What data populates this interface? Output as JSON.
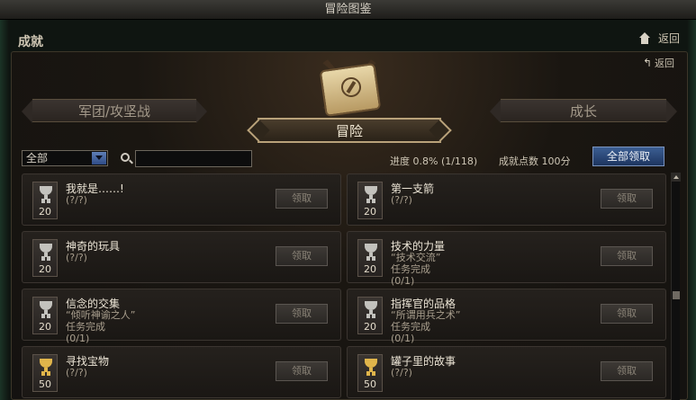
{
  "window": {
    "title": "冒险图鉴"
  },
  "header": {
    "section_title": "成就",
    "back_label": "返回",
    "secondary_back_label": "返回"
  },
  "tabs": {
    "left": "军团/攻坚战",
    "center": "冒险",
    "right": "成长"
  },
  "filter": {
    "selected": "全部"
  },
  "search": {
    "value": "",
    "placeholder": ""
  },
  "stats": {
    "progress_text": "进度  0.8% (1/118)",
    "points_text": "成就点数 100分",
    "claim_all_label": "全部领取"
  },
  "claim_label": "领取",
  "achievements": [
    {
      "title": "我就是……!",
      "points": "20",
      "trophy": "silver",
      "lines": [
        "(?/?)"
      ]
    },
    {
      "title": "第一支箭",
      "points": "20",
      "trophy": "silver",
      "lines": [
        "(?/?)"
      ]
    },
    {
      "title": "神奇的玩具",
      "points": "20",
      "trophy": "silver",
      "lines": [
        "(?/?)"
      ]
    },
    {
      "title": "技术的力量",
      "points": "20",
      "trophy": "silver",
      "lines": [
        "“技术交流”",
        "任务完成",
        "(0/1)"
      ]
    },
    {
      "title": "信念的交集",
      "points": "20",
      "trophy": "silver",
      "lines": [
        "“倾听神谕之人”",
        "任务完成",
        "(0/1)"
      ]
    },
    {
      "title": "指挥官的品格",
      "points": "20",
      "trophy": "silver",
      "lines": [
        "“所谓用兵之术”",
        "任务完成",
        "(0/1)"
      ]
    },
    {
      "title": "寻找宝物",
      "points": "50",
      "trophy": "gold",
      "lines": [
        "(?/?)"
      ]
    },
    {
      "title": "罐子里的故事",
      "points": "50",
      "trophy": "gold",
      "lines": [
        "(?/?)"
      ]
    }
  ]
}
